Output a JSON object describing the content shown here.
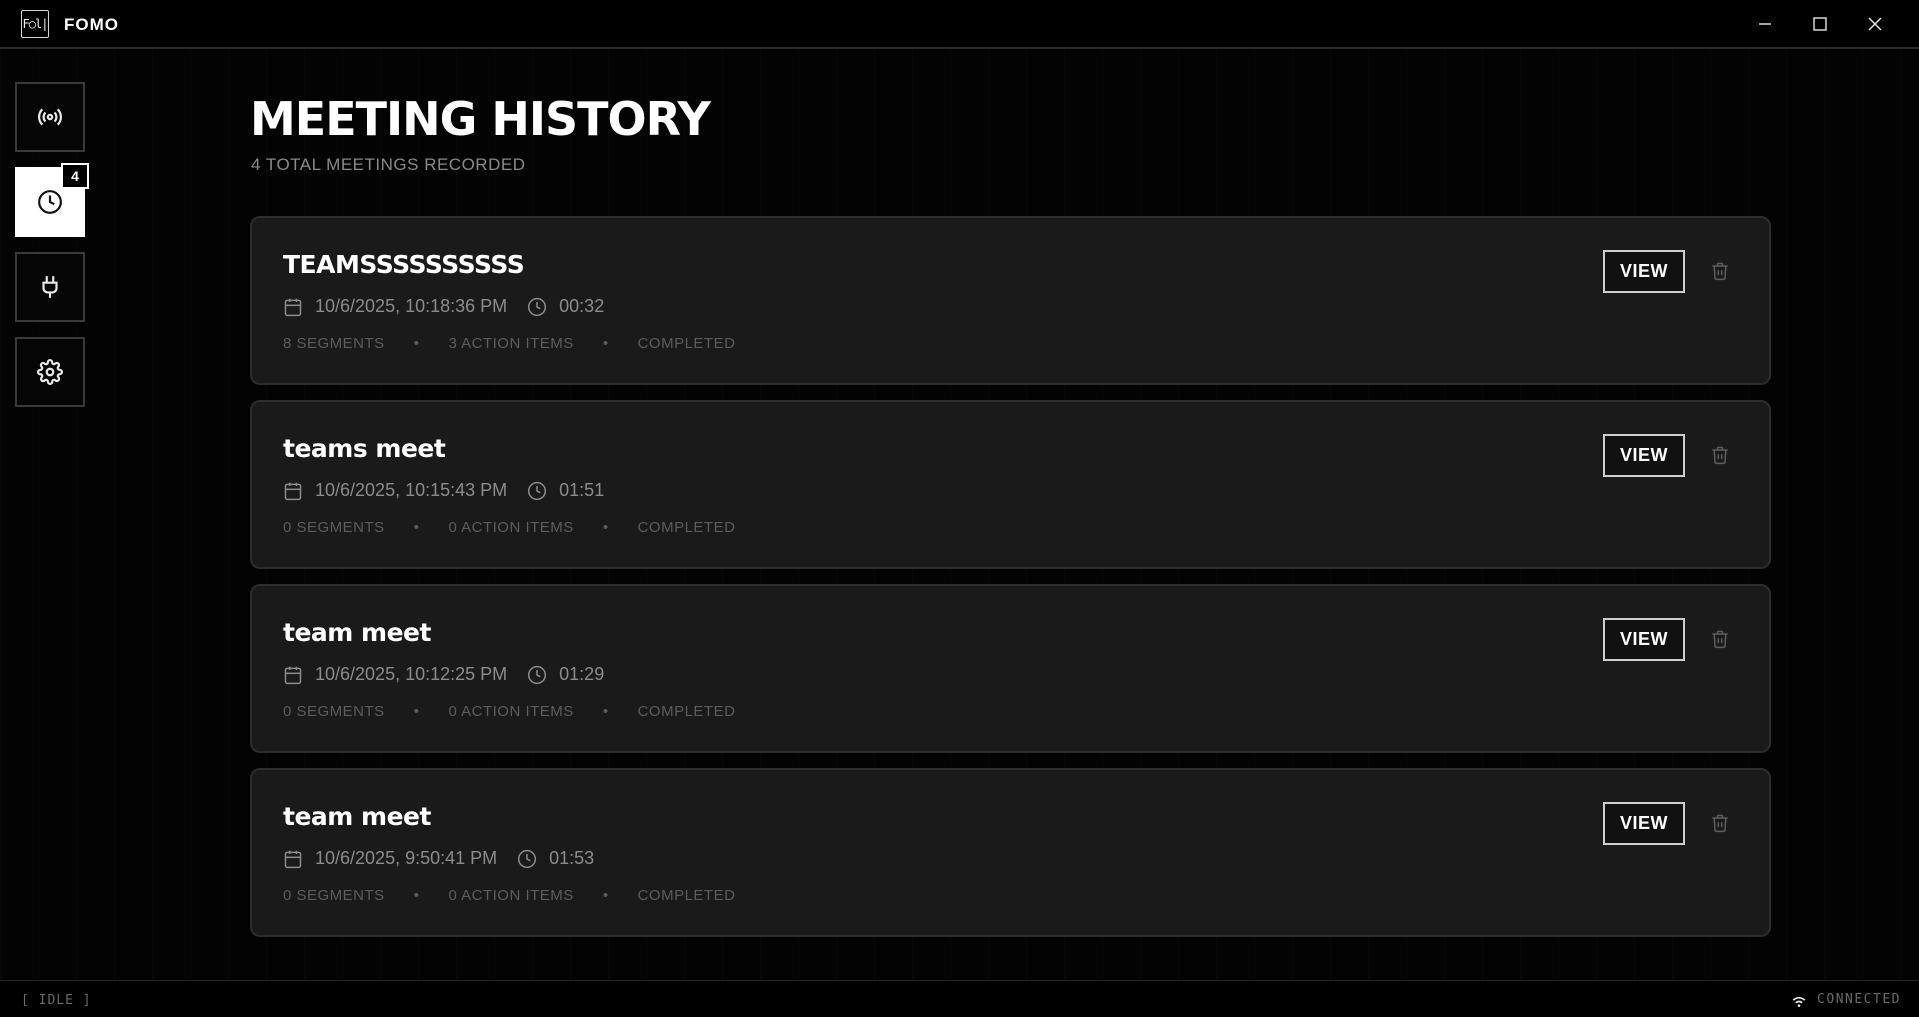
{
  "app": {
    "logo_text": "F○l|",
    "title": "FOMO"
  },
  "window_controls": [
    "minimize-icon",
    "maximize-icon",
    "close-icon"
  ],
  "sidebar": {
    "items": [
      {
        "name": "live",
        "icon": "broadcast-icon"
      },
      {
        "name": "history",
        "icon": "clock-icon",
        "badge": "4",
        "active": true
      },
      {
        "name": "integrations",
        "icon": "plug-icon"
      },
      {
        "name": "settings",
        "icon": "gear-icon"
      }
    ]
  },
  "main": {
    "title": "MEETING HISTORY",
    "subtitle": "4 TOTAL MEETINGS RECORDED",
    "view_label": "VIEW",
    "meetings": [
      {
        "title": "TEAMSSSSSSSSSS",
        "datetime": "10/6/2025, 10:18:36 PM",
        "duration": "00:32",
        "segments": "8 SEGMENTS",
        "action_items": "3 ACTION ITEMS",
        "status": "COMPLETED"
      },
      {
        "title": "teams meet",
        "datetime": "10/6/2025, 10:15:43 PM",
        "duration": "01:51",
        "segments": "0 SEGMENTS",
        "action_items": "0 ACTION ITEMS",
        "status": "COMPLETED"
      },
      {
        "title": "team meet",
        "datetime": "10/6/2025, 10:12:25 PM",
        "duration": "01:29",
        "segments": "0 SEGMENTS",
        "action_items": "0 ACTION ITEMS",
        "status": "COMPLETED"
      },
      {
        "title": "team meet",
        "datetime": "10/6/2025, 9:50:41 PM",
        "duration": "01:53",
        "segments": "0 SEGMENTS",
        "action_items": "0 ACTION ITEMS",
        "status": "COMPLETED"
      }
    ]
  },
  "statusbar": {
    "left": "[ IDLE ]",
    "right": "CONNECTED",
    "right_icon": "wifi-icon"
  }
}
